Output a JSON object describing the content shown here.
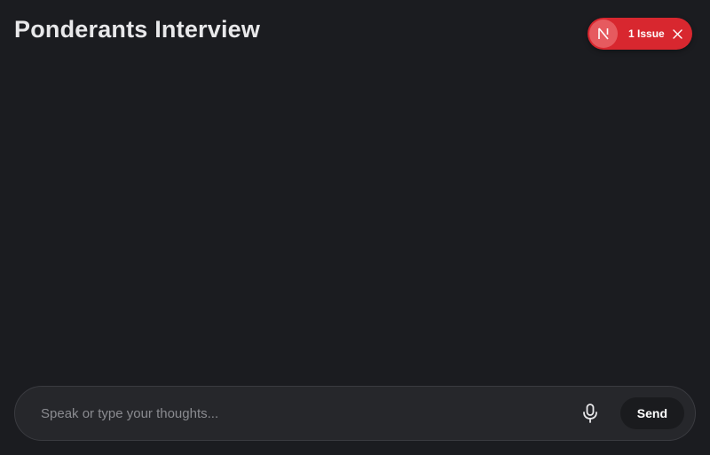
{
  "header": {
    "title": "Ponderants Interview"
  },
  "dev_overlay": {
    "badge_letter": "N",
    "issue_label": "1 Issue",
    "badge_icon": "nextjs-logo-icon",
    "close_icon": "close-icon",
    "pill_color": "#d8272f"
  },
  "composer": {
    "placeholder": "Speak or type your thoughts...",
    "value": "",
    "mic_icon": "microphone-icon",
    "send_label": "Send"
  },
  "colors": {
    "background": "#1b1c20",
    "composer_bg": "#26272b",
    "send_bg": "#1a1b1e"
  }
}
